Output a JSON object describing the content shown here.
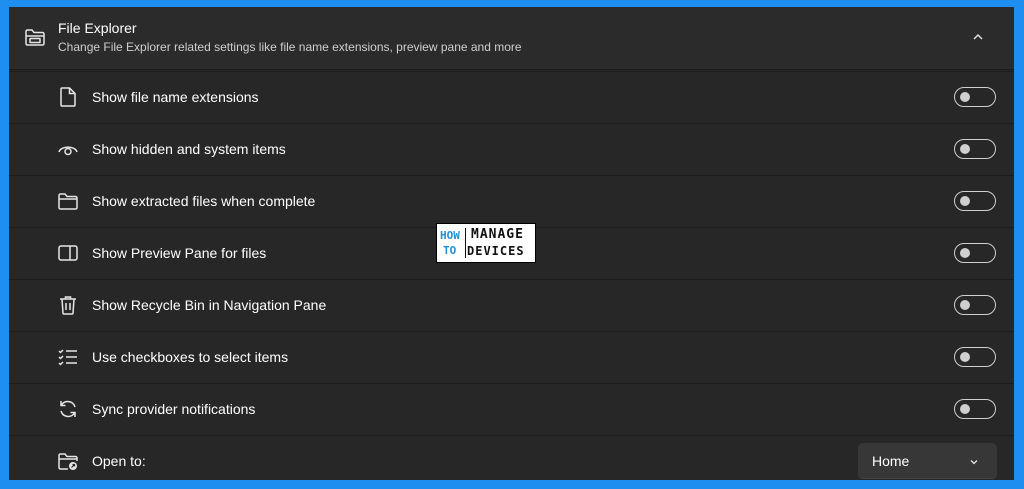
{
  "header": {
    "title": "File Explorer",
    "subtitle": "Change File Explorer related settings like file name extensions, preview pane and more",
    "icon": "file-explorer-icon",
    "collapse_icon": "chevron-up-icon"
  },
  "settings": [
    {
      "label": "Show file name extensions",
      "icon": "document-icon",
      "state": "off"
    },
    {
      "label": "Show hidden and system items",
      "icon": "eye-icon",
      "state": "off"
    },
    {
      "label": "Show extracted files when complete",
      "icon": "folder-icon",
      "state": "off"
    },
    {
      "label": "Show Preview Pane for files",
      "icon": "preview-pane-icon",
      "state": "off"
    },
    {
      "label": "Show Recycle Bin in Navigation Pane",
      "icon": "trash-icon",
      "state": "off"
    },
    {
      "label": "Use checkboxes to select items",
      "icon": "checklist-icon",
      "state": "off"
    },
    {
      "label": "Sync provider notifications",
      "icon": "sync-icon",
      "state": "off"
    }
  ],
  "open_to": {
    "label": "Open to:",
    "icon": "folder-open-icon",
    "selected": "Home"
  },
  "watermark": {
    "how": "HOW",
    "to": "TO",
    "manage": "MANAGE",
    "devices": "DEVICES"
  },
  "colors": {
    "background": "#1e8ff1",
    "panel": "#272727",
    "header": "#2b2b2b",
    "toggle_off": "#cfcfcf"
  }
}
